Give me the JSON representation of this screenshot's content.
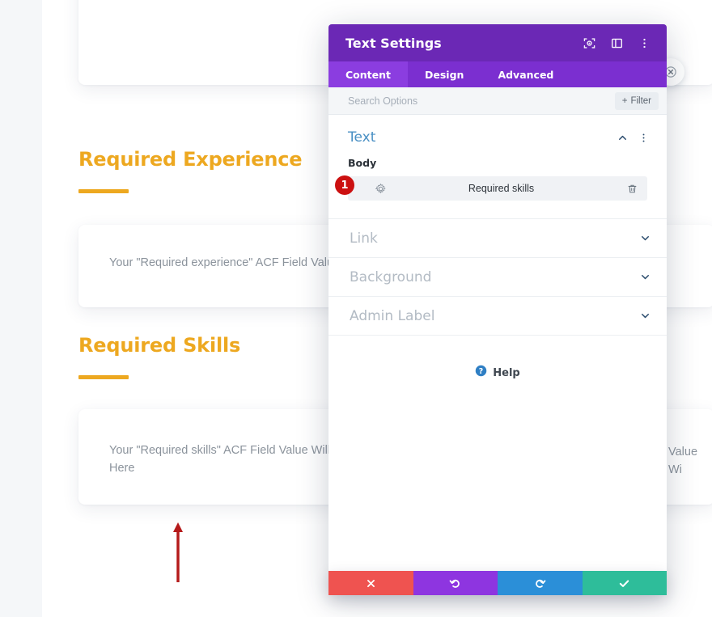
{
  "background_page": {
    "headings": [
      {
        "text": "Required Experience"
      },
      {
        "text": "Required Skills"
      }
    ],
    "cards": [
      {
        "text": "Your \"Required experience\" ACF Field Value Will Show Here"
      },
      {
        "text": "Your \"Required skills\" ACF Field Value Will Show\nHere"
      }
    ],
    "right_overflow_text": "Value Wi",
    "accent_color": "#eda820",
    "annotation": {
      "name": "red-arrow",
      "color": "#b51a1a"
    }
  },
  "modal": {
    "title": "Text Settings",
    "titlebar_color": "#6b28b5",
    "title_icons": [
      {
        "name": "focus-target-icon"
      },
      {
        "name": "panel-layout-icon"
      },
      {
        "name": "kebab-menu-icon"
      }
    ],
    "tabs": [
      {
        "label": "Content",
        "active": true
      },
      {
        "label": "Design",
        "active": false
      },
      {
        "label": "Advanced",
        "active": false
      }
    ],
    "search": {
      "placeholder": "Search Options",
      "value": "",
      "filter_label": "Filter"
    },
    "open_section": {
      "title": "Text",
      "field_label": "Body",
      "dynamic_row": {
        "badge": "1",
        "value": "Required skills",
        "gear_icon": "gear-icon",
        "delete_icon": "trash-icon"
      }
    },
    "closed_sections": [
      {
        "title": "Link"
      },
      {
        "title": "Background"
      },
      {
        "title": "Admin Label"
      }
    ],
    "help": {
      "label": "Help"
    },
    "actions": [
      {
        "name": "cancel",
        "icon": "close-x-icon",
        "color": "#ef5350"
      },
      {
        "name": "undo",
        "icon": "undo-arrow-icon",
        "color": "#8e35e0"
      },
      {
        "name": "redo",
        "icon": "redo-arrow-icon",
        "color": "#2b8fd8"
      },
      {
        "name": "save",
        "icon": "checkmark-icon",
        "color": "#2ebd9a"
      }
    ]
  }
}
